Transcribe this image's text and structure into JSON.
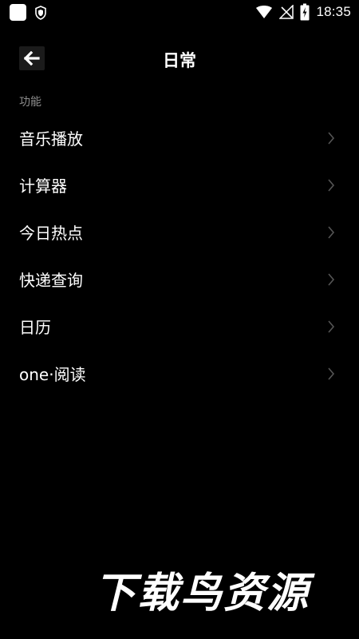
{
  "status_bar": {
    "time": "18:35",
    "icons": [
      "app-icon",
      "shield-icon",
      "wifi-icon",
      "signal-icon",
      "battery-charging-icon"
    ]
  },
  "app_bar": {
    "back_icon": "arrow-left-icon",
    "title": "日常"
  },
  "section": {
    "header": "功能",
    "items": [
      {
        "label": "音乐播放"
      },
      {
        "label": "计算器"
      },
      {
        "label": "今日热点"
      },
      {
        "label": "快递查询"
      },
      {
        "label": "日历"
      },
      {
        "label": "one·阅读"
      }
    ]
  },
  "watermark": {
    "text": "下载鸟资源"
  },
  "colors": {
    "background": "#000000",
    "text": "#ffffff",
    "muted": "#8d8d8d",
    "chevron": "#555555"
  }
}
